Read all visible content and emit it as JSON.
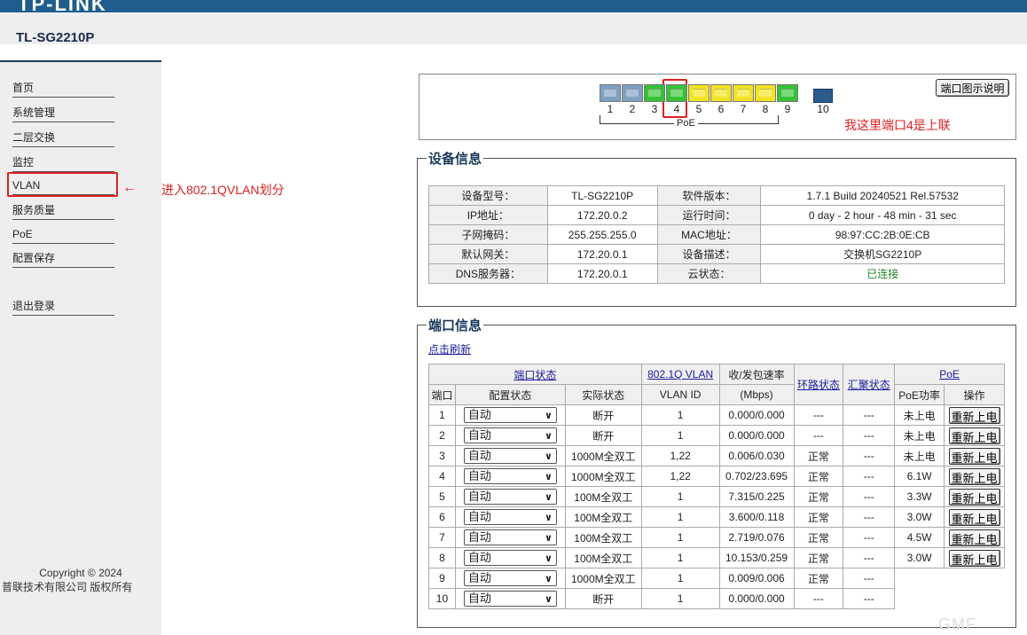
{
  "header": {
    "brand": "TP-LINK",
    "model": "TL-SG2210P"
  },
  "sidebar": {
    "items": [
      {
        "label": "首页"
      },
      {
        "label": "系统管理"
      },
      {
        "label": "二层交换"
      },
      {
        "label": "监控"
      },
      {
        "label": "VLAN"
      },
      {
        "label": "服务质量"
      },
      {
        "label": "PoE"
      },
      {
        "label": "配置保存"
      },
      {
        "label": "退出登录"
      }
    ],
    "footer_line1": "Copyright © 2024",
    "footer_line2": "普联技术有限公司 版权所有"
  },
  "annotations": {
    "vlan_note": "进入802.1QVLAN划分",
    "port_note": "我这里端口4是上联"
  },
  "port_diagram": {
    "ports": [
      {
        "num": "1",
        "status": "gray"
      },
      {
        "num": "2",
        "status": "gray"
      },
      {
        "num": "3",
        "status": "green"
      },
      {
        "num": "4",
        "status": "green"
      },
      {
        "num": "5",
        "status": "yellow"
      },
      {
        "num": "6",
        "status": "yellow"
      },
      {
        "num": "7",
        "status": "yellow"
      },
      {
        "num": "8",
        "status": "yellow"
      },
      {
        "num": "9",
        "status": "green"
      },
      {
        "num": "10",
        "status": "sfp"
      }
    ],
    "poe_label": "PoE",
    "legend_button": "端口图示说明",
    "colors": {
      "down": "#7fa0c0",
      "gigabit": "#35c235",
      "fast": "#f2e320"
    }
  },
  "device_info": {
    "title": "设备信息",
    "rows": [
      [
        "设备型号：",
        "TL-SG2210P",
        "软件版本：",
        "1.7.1 Build 20240521 Rel.57532"
      ],
      [
        "IP地址：",
        "172.20.0.2",
        "运行时间：",
        "0 day - 2 hour - 48 min - 31 sec"
      ],
      [
        "子网掩码：",
        "255.255.255.0",
        "MAC地址：",
        "98:97:CC:2B:0E:CB"
      ],
      [
        "默认网关：",
        "172.20.0.1",
        "设备描述：",
        "交换机SG2210P"
      ],
      [
        "DNS服务器：",
        "172.20.0.1",
        "云状态：",
        "已连接"
      ]
    ]
  },
  "port_info": {
    "title": "端口信息",
    "refresh": "点击刷新",
    "headers": {
      "port_status": "端口状态",
      "vlan": "802.1Q VLAN",
      "rate": "收/发包速率",
      "rate_unit": "(Mbps)",
      "loop": "环路状态",
      "agg": "汇聚状态",
      "poe": "PoE",
      "port": "端口",
      "config": "配置状态",
      "actual": "实际状态",
      "vlan_id": "VLAN ID",
      "poe_power": "PoE功率",
      "action": "操作"
    },
    "rows": [
      {
        "port": "1",
        "config": "自动",
        "actual": "断开",
        "vlan": "1",
        "rate": "0.000/0.000",
        "loop": "---",
        "agg": "---",
        "power": "未上电",
        "btn": "重新上电"
      },
      {
        "port": "2",
        "config": "自动",
        "actual": "断开",
        "vlan": "1",
        "rate": "0.000/0.000",
        "loop": "---",
        "agg": "---",
        "power": "未上电",
        "btn": "重新上电"
      },
      {
        "port": "3",
        "config": "自动",
        "actual": "1000M全双工",
        "vlan": "1,22",
        "rate": "0.006/0.030",
        "loop": "正常",
        "agg": "---",
        "power": "未上电",
        "btn": "重新上电"
      },
      {
        "port": "4",
        "config": "自动",
        "actual": "1000M全双工",
        "vlan": "1,22",
        "rate": "0.702/23.695",
        "loop": "正常",
        "agg": "---",
        "power": "6.1W",
        "btn": "重新上电"
      },
      {
        "port": "5",
        "config": "自动",
        "actual": "100M全双工",
        "vlan": "1",
        "rate": "7.315/0.225",
        "loop": "正常",
        "agg": "---",
        "power": "3.3W",
        "btn": "重新上电"
      },
      {
        "port": "6",
        "config": "自动",
        "actual": "100M全双工",
        "vlan": "1",
        "rate": "3.600/0.118",
        "loop": "正常",
        "agg": "---",
        "power": "3.0W",
        "btn": "重新上电"
      },
      {
        "port": "7",
        "config": "自动",
        "actual": "100M全双工",
        "vlan": "1",
        "rate": "2.719/0.076",
        "loop": "正常",
        "agg": "---",
        "power": "4.5W",
        "btn": "重新上电"
      },
      {
        "port": "8",
        "config": "自动",
        "actual": "100M全双工",
        "vlan": "1",
        "rate": "10.153/0.259",
        "loop": "正常",
        "agg": "---",
        "power": "3.0W",
        "btn": "重新上电"
      },
      {
        "port": "9",
        "config": "自动",
        "actual": "1000M全双工",
        "vlan": "1",
        "rate": "0.009/0.006",
        "loop": "正常",
        "agg": "---"
      },
      {
        "port": "10",
        "config": "自动",
        "actual": "断开",
        "vlan": "1",
        "rate": "0.000/0.000",
        "loop": "---",
        "agg": "---"
      }
    ]
  }
}
